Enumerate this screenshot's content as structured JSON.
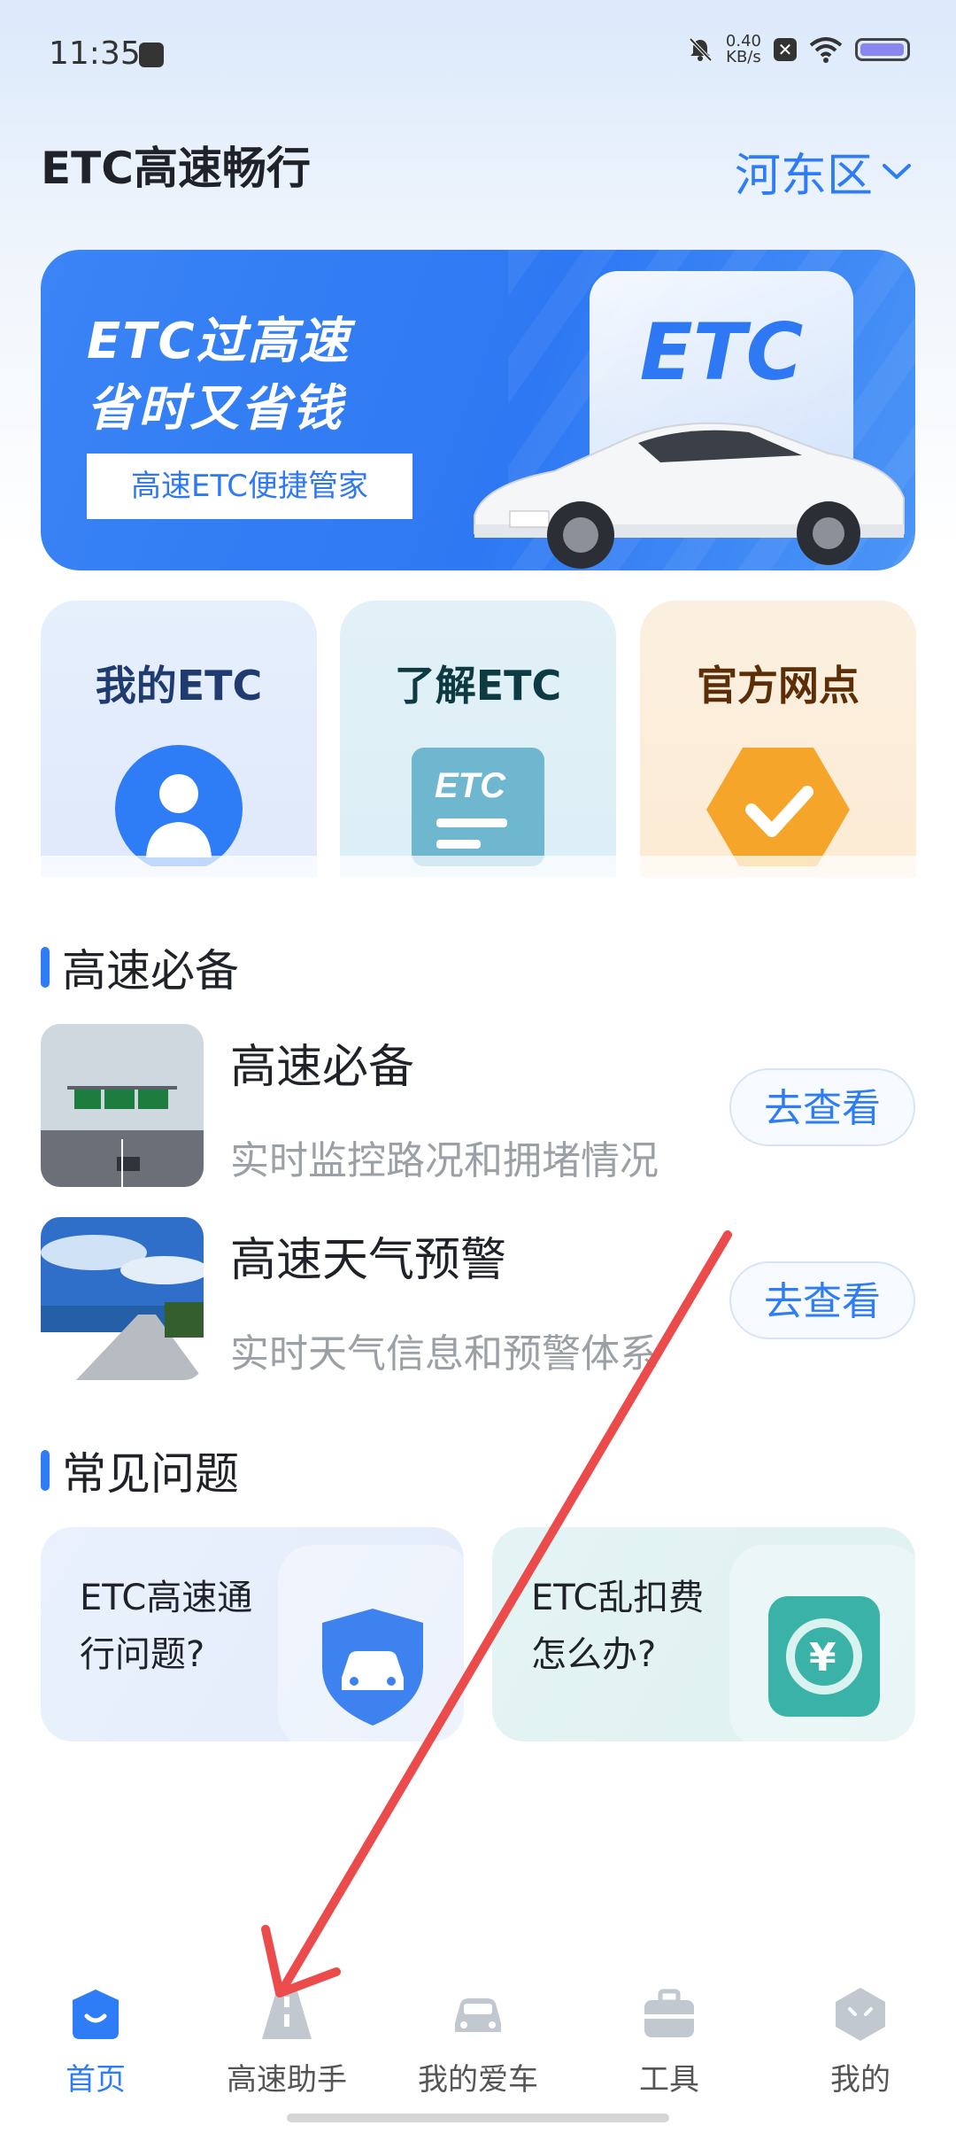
{
  "status_bar": {
    "time": "11:35",
    "net_speed_value": "0.40",
    "net_speed_unit": "KB/s"
  },
  "header": {
    "title": "ETC高速畅行",
    "region": "河东区"
  },
  "banner": {
    "line1": "ETC过高速",
    "line2": "省时又省钱",
    "subtitle": "高速ETC便捷管家",
    "badge": "ETC"
  },
  "features": [
    {
      "label": "我的ETC"
    },
    {
      "label": "了解ETC",
      "icon_text": "ETC"
    },
    {
      "label": "官方网点"
    }
  ],
  "highway_section": {
    "title": "高速必备",
    "items": [
      {
        "title": "高速必备",
        "desc": "实时监控路况和拥堵情况",
        "button": "去查看"
      },
      {
        "title": "高速天气预警",
        "desc": "实时天气信息和预警体系",
        "button": "去查看"
      }
    ]
  },
  "faq_section": {
    "title": "常见问题",
    "items": [
      {
        "question": "ETC高速通\n行问题?"
      },
      {
        "question": "ETC乱扣费\n怎么办?"
      }
    ]
  },
  "tabs": [
    {
      "label": "首页",
      "active": true
    },
    {
      "label": "高速助手",
      "active": false
    },
    {
      "label": "我的爱车",
      "active": false
    },
    {
      "label": "工具",
      "active": false
    },
    {
      "label": "我的",
      "active": false
    }
  ],
  "colors": {
    "accent": "#2e7cf6",
    "annotation_arrow": "#ec4b4b"
  }
}
